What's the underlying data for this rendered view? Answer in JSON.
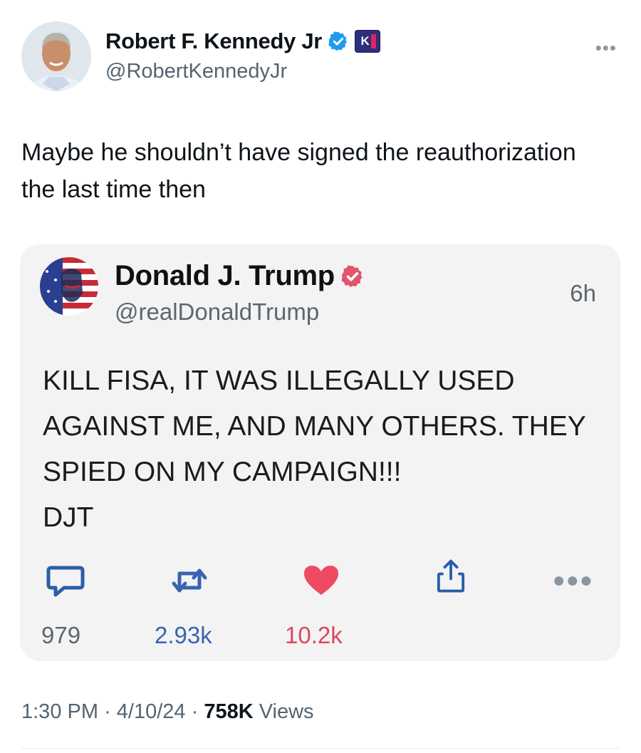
{
  "author": {
    "name": "Robert F. Kennedy Jr",
    "handle": "@RobertKennedyJr",
    "affiliation_badge": "K"
  },
  "tweet": {
    "text": "Maybe he shouldn’t have signed the reauthorization the last time then"
  },
  "quoted": {
    "name": "Donald J. Trump",
    "handle": "@realDonaldTrump",
    "time": "6h",
    "text": "KILL FISA, IT WAS ILLEGALLY USED AGAINST ME, AND MANY OTHERS. THEY SPIED ON MY CAMPAIGN!!!\nDJT",
    "counts": {
      "replies": "979",
      "reposts": "2.93k",
      "likes": "10.2k"
    }
  },
  "meta": {
    "time": "1:30 PM",
    "date": "4/10/24",
    "views_count": "758K",
    "views_label": "Views"
  },
  "colors": {
    "verified_blue": "#1d9bf0",
    "quote_badge": "#e1566c",
    "reply_blue": "#2a5ea8",
    "repost_blue": "#3a63b0",
    "like_red": "#ee4a62"
  },
  "icons": {
    "more": "more-horizontal-icon",
    "reply": "reply-bubble-icon",
    "repost": "repost-icon",
    "like": "heart-icon",
    "share": "share-icon"
  }
}
